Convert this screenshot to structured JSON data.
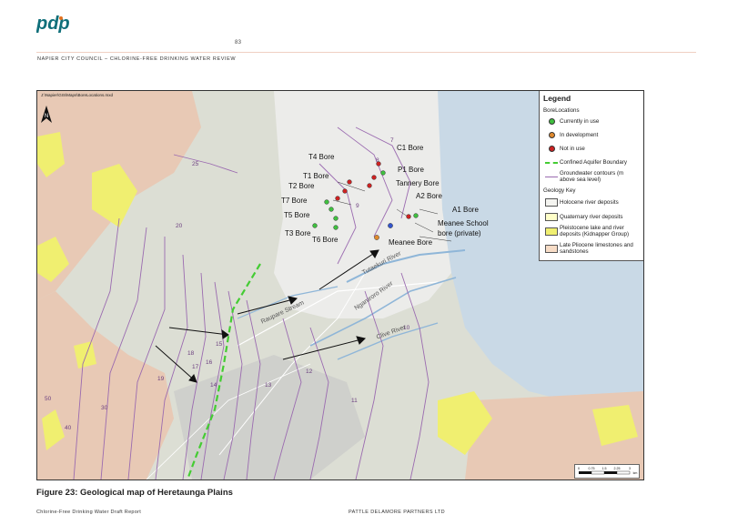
{
  "header": {
    "logo_text": "pdp",
    "page_number": "83",
    "document_title": "NAPIER CITY COUNCIL – CHLORINE-FREE DRINKING WATER REVIEW"
  },
  "map": {
    "file_path_text": "J:\\Napier\\GIS\\Maps\\BoreLocations.mxd",
    "north_arrow_label": "N",
    "legend": {
      "title": "Legend",
      "bore_heading": "BoreLocations",
      "bore_items": [
        {
          "label": "Currently in use",
          "color": "#3fbf3f"
        },
        {
          "label": "In development",
          "color": "#e08a2e"
        },
        {
          "label": "Not in use",
          "color": "#cc2222"
        }
      ],
      "lines": [
        {
          "label": "Confined Aquifer Boundary",
          "color": "#44cc33"
        },
        {
          "label": "Groundwater contours (m above sea level)",
          "color": "#9b6bb0"
        }
      ],
      "geology_heading": "Geology Key",
      "geology_items": [
        {
          "label": "Holocene river deposits",
          "color": "#f4f4f0"
        },
        {
          "label": "Quaternary river deposits",
          "color": "#ffffc8"
        },
        {
          "label": "Pleistocene lake and river deposits (Kidnapper Group)",
          "color": "#f0ef70"
        },
        {
          "label": "Late Pliocene limestones and sandstones",
          "color": "#f7dcc6"
        }
      ]
    },
    "bore_labels": {
      "t4": "T4 Bore",
      "c1": "C1 Bore",
      "t1": "T1 Bore",
      "p1": "P1 Bore",
      "t2": "T2 Bore",
      "tannery": "Tannery Bore",
      "t7": "T7 Bore",
      "a2": "A2 Bore",
      "a1": "A1 Bore",
      "t5": "T5 Bore",
      "meanee_school": "Meanee School",
      "meanee_school_2": "bore (private)",
      "t3": "T3 Bore",
      "t6": "T6 Bore",
      "meanee": "Meanee Bore"
    },
    "river_labels": {
      "tutaekuri": "Tutaekuri River",
      "ngaruroro": "Ngaruroro River",
      "raupare": "Raupare Stream",
      "clive": "Clive River"
    },
    "contour_labels": [
      "7",
      "8",
      "9",
      "10",
      "11",
      "12",
      "13",
      "14",
      "15",
      "16",
      "17",
      "18",
      "19",
      "20",
      "25",
      "30",
      "40",
      "50"
    ],
    "scale_labels": [
      "0",
      "0.75",
      "1.5",
      "2.25",
      "3"
    ],
    "scale_unit": "km"
  },
  "caption": "Figure 23: Geological map of Heretaunga Plains",
  "footer": {
    "left": "Chlorine-Free Drinking Water Draft Report",
    "right": "PATTLE DELAMORE PARTNERS LTD"
  }
}
